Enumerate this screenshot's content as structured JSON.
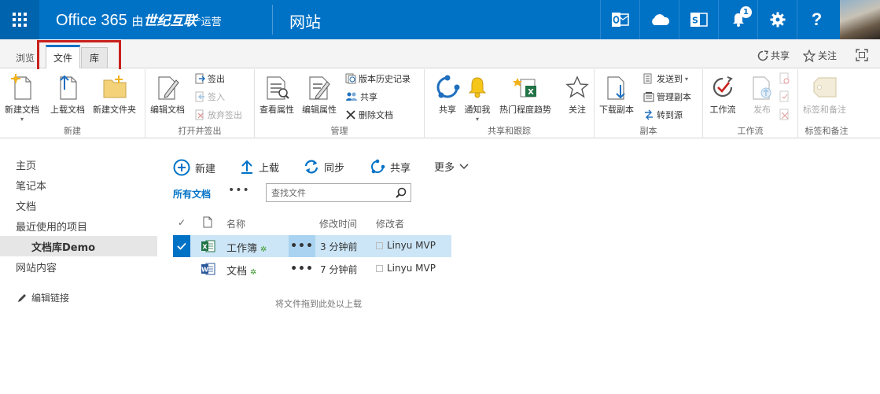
{
  "suitebar": {
    "brand_main": "Office 365",
    "brand_by": "由",
    "brand_partner": "世纪互联",
    "brand_op": "运营",
    "site_title": "网站",
    "notification_count": "1",
    "help_label": "?"
  },
  "tabs": {
    "browse": "浏览",
    "file": "文件",
    "library": "库"
  },
  "top_actions": {
    "share": "共享",
    "follow": "关注"
  },
  "ribbon": {
    "new_group": {
      "label": "新建",
      "new_document": "新建文档",
      "upload_document": "上载文档",
      "new_folder": "新建文件夹"
    },
    "open_checkout_group": {
      "label": "打开并签出",
      "edit_document": "编辑文档",
      "check_out": "签出",
      "check_in": "签入",
      "discard_checkout": "放弃签出"
    },
    "manage_group": {
      "label": "管理",
      "view_properties": "查看属性",
      "edit_properties": "编辑属性",
      "version_history": "版本历史记录",
      "share": "共享",
      "delete_document": "删除文档"
    },
    "share_track_group": {
      "label": "共享和跟踪",
      "share": "共享",
      "alert_me": "通知我",
      "popularity_trends": "热门程度趋势",
      "follow": "关注"
    },
    "copies_group": {
      "label": "副本",
      "download_copy": "下载副本",
      "send_to": "发送到",
      "manage_copies": "管理副本",
      "go_to_source": "转到源"
    },
    "workflows_group": {
      "label": "工作流",
      "workflows": "工作流",
      "publish": "发布"
    },
    "tags_group": {
      "label": "标签和备注",
      "tags_notes": "标签和备注"
    }
  },
  "leftnav": {
    "items": [
      "主页",
      "笔记本",
      "文档",
      "最近使用的项目"
    ],
    "active": "文档库Demo",
    "site_contents": "网站内容",
    "edit_links": "编辑链接"
  },
  "commands": {
    "new": "新建",
    "upload": "上载",
    "sync": "同步",
    "share": "共享",
    "more": "更多"
  },
  "view": {
    "name": "所有文档",
    "more_dots": "•••",
    "search_placeholder": "查找文件"
  },
  "columns": {
    "check": "✓",
    "name": "名称",
    "modified": "修改时间",
    "modified_by": "修改者"
  },
  "rows": [
    {
      "name": "工作簿",
      "type": "excel",
      "modified": "3 分钟前",
      "editor": "Linyu MVP",
      "ellipsis": "•••"
    },
    {
      "name": "文档",
      "type": "word",
      "modified": "7 分钟前",
      "editor": "Linyu MVP",
      "ellipsis": "•••"
    }
  ],
  "drop_hint": "将文件拖到此处以上载",
  "colors": {
    "suite_blue": "#0072c6",
    "highlight_red": "#c9211e",
    "selected_row": "#cde6f7"
  }
}
